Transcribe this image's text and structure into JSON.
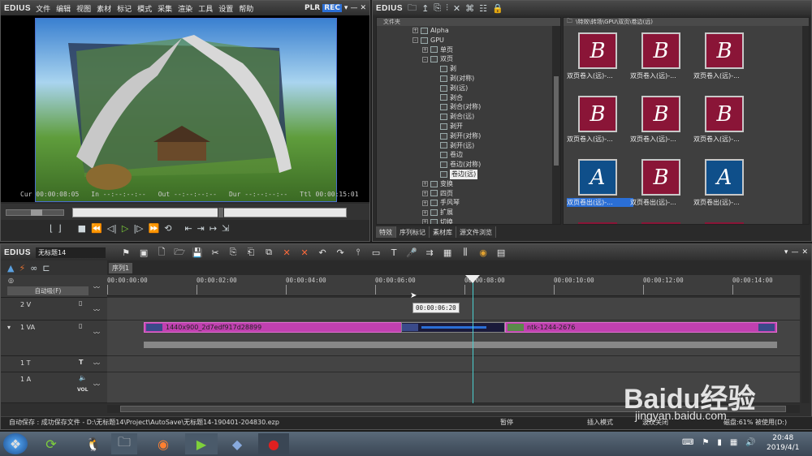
{
  "player": {
    "logo": "EDIUS",
    "menu": [
      "文件",
      "编辑",
      "视图",
      "素材",
      "标记",
      "模式",
      "采集",
      "渲染",
      "工具",
      "设置",
      "帮助"
    ],
    "plr": "PLR",
    "rec": "REC",
    "cur_label": "Cur",
    "cur": "00:00:08:05",
    "in_label": "In",
    "in": "--:--:--:--",
    "out_label": "Out",
    "out": "--:--:--:--",
    "dur_label": "Dur",
    "dur": "--:--:--:--",
    "ttl_label": "Ttl",
    "ttl": "00:00:15:01"
  },
  "library": {
    "logo": "EDIUS",
    "folder_header": "文件夹",
    "path": "\\特效\\转场\\GPU\\双页\\卷边(远)",
    "tree": [
      {
        "label": "Alpha",
        "indent": 0,
        "exp": "+"
      },
      {
        "label": "GPU",
        "indent": 0,
        "exp": "-"
      },
      {
        "label": "单页",
        "indent": 1,
        "exp": "+"
      },
      {
        "label": "双页",
        "indent": 1,
        "exp": "-"
      },
      {
        "label": "剥",
        "indent": 2,
        "exp": ""
      },
      {
        "label": "剥(对称)",
        "indent": 2,
        "exp": ""
      },
      {
        "label": "剥(远)",
        "indent": 2,
        "exp": ""
      },
      {
        "label": "剥合",
        "indent": 2,
        "exp": ""
      },
      {
        "label": "剥合(对称)",
        "indent": 2,
        "exp": ""
      },
      {
        "label": "剥合(远)",
        "indent": 2,
        "exp": ""
      },
      {
        "label": "剥开",
        "indent": 2,
        "exp": ""
      },
      {
        "label": "剥开(对称)",
        "indent": 2,
        "exp": ""
      },
      {
        "label": "剥开(远)",
        "indent": 2,
        "exp": ""
      },
      {
        "label": "卷边",
        "indent": 2,
        "exp": ""
      },
      {
        "label": "卷边(对称)",
        "indent": 2,
        "exp": ""
      },
      {
        "label": "卷边(远)",
        "indent": 2,
        "exp": "",
        "selected": true
      },
      {
        "label": "变换",
        "indent": 1,
        "exp": "+"
      },
      {
        "label": "四页",
        "indent": 1,
        "exp": "+"
      },
      {
        "label": "手风琴",
        "indent": 1,
        "exp": "+"
      },
      {
        "label": "扩展",
        "indent": 1,
        "exp": "+"
      },
      {
        "label": "切换",
        "indent": 1,
        "exp": "+"
      }
    ],
    "thumbs": [
      {
        "letter": "B",
        "label": "双页卷入(远)-...",
        "color": "red"
      },
      {
        "letter": "B",
        "label": "双页卷入(远)-...",
        "color": "red"
      },
      {
        "letter": "B",
        "label": "双页卷入(远)-...",
        "color": "red"
      },
      {
        "letter": "B",
        "label": "双页卷入(远)-...",
        "color": "red"
      },
      {
        "letter": "B",
        "label": "双页卷入(远)-...",
        "color": "red"
      },
      {
        "letter": "B",
        "label": "双页卷入(远)-...",
        "color": "red"
      },
      {
        "letter": "A",
        "label": "双页卷出(远)-...",
        "color": "blue",
        "selected": true
      },
      {
        "letter": "B",
        "label": "双页卷出(远)-...",
        "color": "red"
      },
      {
        "letter": "A",
        "label": "双页卷出(远)-...",
        "color": "blue"
      }
    ],
    "tabs": [
      "特效",
      "序列标记",
      "素材库",
      "源文件浏览"
    ]
  },
  "timeline": {
    "logo": "EDIUS",
    "project": "无标题14",
    "sequence_tab": "序列1",
    "mode": "自动吸(F)",
    "ruler": [
      "00:00:00:00",
      "00:00:02:00",
      "00:00:04:00",
      "00:00:06:00",
      "00:00:08:00",
      "00:00:10:00",
      "00:00:12:00",
      "00:00:14:00"
    ],
    "tooltip": "00:00:06:20",
    "tracks": [
      {
        "name": "2 V"
      },
      {
        "name": "1 VA"
      },
      {
        "name": "1 T"
      },
      {
        "name": "1 A"
      }
    ],
    "vol": "VOL",
    "clip1": "1440x900_2d7edf917d28899",
    "clip2": "ntk-1244-2676"
  },
  "status": {
    "autosave": "自动保存 : 成功保存文件 - D:\\无标题14\\Project\\AutoSave\\无标题14-190401-204830.ezp",
    "pause": "暂停",
    "insert": "插入模式",
    "ripple": "波纹关闭",
    "disk": "磁盘:61% 被使用(D:)"
  },
  "taskbar": {
    "time": "20:48",
    "date": "2019/4/1"
  },
  "watermark": {
    "text": "Baidu经验",
    "url": "jingyan.baidu.com"
  },
  "colors": {
    "clip": "#c040b0",
    "accent": "#2b6fd6",
    "playhead": "#4ad0d0"
  }
}
